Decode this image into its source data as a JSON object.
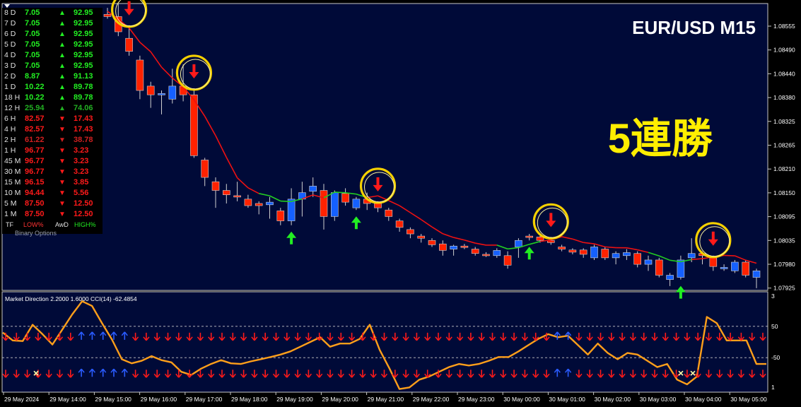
{
  "header": {
    "symbol_timeframe": "EUR/USD M15",
    "banner": "5連勝"
  },
  "colors": {
    "background": "#000",
    "chart_bg": "#000a38",
    "bull_candle": "#1560ff",
    "bear_candle": "#ff2200",
    "down_line": "#ee1111",
    "up_line": "#22cc22",
    "oscillator": "#ff9f1a",
    "banner": "#ffee00",
    "ring": "#f5d000"
  },
  "signal_panel": {
    "rows": [
      {
        "tf": "8 D",
        "low": "7.05",
        "dir": "up",
        "high": "92.95"
      },
      {
        "tf": "7 D",
        "low": "7.05",
        "dir": "up",
        "high": "92.95"
      },
      {
        "tf": "6 D",
        "low": "7.05",
        "dir": "up",
        "high": "92.95"
      },
      {
        "tf": "5 D",
        "low": "7.05",
        "dir": "up",
        "high": "92.95"
      },
      {
        "tf": "4 D",
        "low": "7.05",
        "dir": "up",
        "high": "92.95"
      },
      {
        "tf": "3 D",
        "low": "7.05",
        "dir": "up",
        "high": "92.95"
      },
      {
        "tf": "2 D",
        "low": "8.87",
        "dir": "up",
        "high": "91.13"
      },
      {
        "tf": "1 D",
        "low": "10.22",
        "dir": "up",
        "high": "89.78"
      },
      {
        "tf": "18 H",
        "low": "10.22",
        "dir": "up",
        "high": "89.78"
      },
      {
        "tf": "12 H",
        "low": "25.94",
        "dir": "up-weak",
        "high": "74.06"
      },
      {
        "tf": "6 H",
        "low": "82.57",
        "dir": "down",
        "high": "17.43"
      },
      {
        "tf": "4 H",
        "low": "82.57",
        "dir": "down",
        "high": "17.43"
      },
      {
        "tf": "2 H",
        "low": "61.22",
        "dir": "down-weak",
        "high": "38.78"
      },
      {
        "tf": "1 H",
        "low": "96.77",
        "dir": "down",
        "high": "3.23"
      },
      {
        "tf": "45 M",
        "low": "96.77",
        "dir": "down",
        "high": "3.23"
      },
      {
        "tf": "30 M",
        "low": "96.77",
        "dir": "down",
        "high": "3.23"
      },
      {
        "tf": "15 M",
        "low": "96.15",
        "dir": "down",
        "high": "3.85"
      },
      {
        "tf": "10 M",
        "low": "94.44",
        "dir": "down",
        "high": "5.56"
      },
      {
        "tf": "5 M",
        "low": "87.50",
        "dir": "down",
        "high": "12.50"
      },
      {
        "tf": "1 M",
        "low": "87.50",
        "dir": "down",
        "high": "12.50"
      }
    ],
    "footer_tf": "TF",
    "footer_low": "LOW%",
    "footer_awd": "AwD",
    "footer_high": "HIGH%",
    "brand": "Binary Options",
    "arrow_up": "▲",
    "arrow_down": "▼"
  },
  "chart_data": [
    {
      "type": "candlestick",
      "symbol": "EUR/USD",
      "timeframe": "M15",
      "ylim": [
        1.07915,
        1.08575
      ],
      "y_ticks": [
        "1.08555",
        "1.08490",
        "1.08440",
        "1.08380",
        "1.08325",
        "1.08265",
        "1.08210",
        "1.08150",
        "1.08095",
        "1.08035",
        "1.07980",
        "1.07925"
      ],
      "x_ticks": [
        "29 May 2024",
        "29 May 14:00",
        "29 May 15:00",
        "29 May 16:00",
        "29 May 17:00",
        "29 May 18:00",
        "29 May 19:00",
        "29 May 20:00",
        "29 May 21:00",
        "29 May 22:00",
        "29 May 23:00",
        "30 May 00:00",
        "30 May 01:00",
        "30 May 02:00",
        "30 May 03:00",
        "30 May 04:00",
        "30 May 05:00"
      ],
      "candles": [
        {
          "o": 1.0855,
          "h": 1.08565,
          "l": 1.0854,
          "c": 1.08545
        },
        {
          "o": 1.08545,
          "h": 1.08575,
          "l": 1.085,
          "c": 1.0851
        },
        {
          "o": 1.08495,
          "h": 1.08525,
          "l": 1.08455,
          "c": 1.08465
        },
        {
          "o": 1.08445,
          "h": 1.08455,
          "l": 1.08355,
          "c": 1.08375
        },
        {
          "o": 1.08385,
          "h": 1.08395,
          "l": 1.08335,
          "c": 1.08365
        },
        {
          "o": 1.08365,
          "h": 1.08375,
          "l": 1.0832,
          "c": 1.08368
        },
        {
          "o": 1.08355,
          "h": 1.08425,
          "l": 1.08345,
          "c": 1.08385
        },
        {
          "o": 1.08385,
          "h": 1.08435,
          "l": 1.0835,
          "c": 1.08365
        },
        {
          "o": 1.08365,
          "h": 1.0838,
          "l": 1.0822,
          "c": 1.08225
        },
        {
          "o": 1.08215,
          "h": 1.0822,
          "l": 1.08155,
          "c": 1.08175
        },
        {
          "o": 1.08165,
          "h": 1.08175,
          "l": 1.08105,
          "c": 1.08145
        },
        {
          "o": 1.08145,
          "h": 1.0816,
          "l": 1.08115,
          "c": 1.08135
        },
        {
          "o": 1.08133,
          "h": 1.08165,
          "l": 1.0812,
          "c": 1.0813
        },
        {
          "o": 1.08125,
          "h": 1.08135,
          "l": 1.08105,
          "c": 1.0811
        },
        {
          "o": 1.08115,
          "h": 1.0812,
          "l": 1.0809,
          "c": 1.0811
        },
        {
          "o": 1.08112,
          "h": 1.0813,
          "l": 1.0808,
          "c": 1.08118
        },
        {
          "o": 1.08098,
          "h": 1.08105,
          "l": 1.08065,
          "c": 1.08075
        },
        {
          "o": 1.08075,
          "h": 1.0815,
          "l": 1.08065,
          "c": 1.08125
        },
        {
          "o": 1.08125,
          "h": 1.08165,
          "l": 1.08085,
          "c": 1.0814
        },
        {
          "o": 1.08143,
          "h": 1.08175,
          "l": 1.0813,
          "c": 1.08155
        },
        {
          "o": 1.08145,
          "h": 1.0816,
          "l": 1.08055,
          "c": 1.08085
        },
        {
          "o": 1.08085,
          "h": 1.08145,
          "l": 1.08075,
          "c": 1.0814
        },
        {
          "o": 1.08138,
          "h": 1.0815,
          "l": 1.0811,
          "c": 1.08118
        },
        {
          "o": 1.08105,
          "h": 1.0813,
          "l": 1.081,
          "c": 1.08125
        },
        {
          "o": 1.08125,
          "h": 1.0814,
          "l": 1.081,
          "c": 1.08115
        },
        {
          "o": 1.08115,
          "h": 1.0812,
          "l": 1.08095,
          "c": 1.08105
        },
        {
          "o": 1.081,
          "h": 1.08105,
          "l": 1.08075,
          "c": 1.08085
        },
        {
          "o": 1.08075,
          "h": 1.0808,
          "l": 1.0805,
          "c": 1.0806
        },
        {
          "o": 1.08055,
          "h": 1.0806,
          "l": 1.08035,
          "c": 1.08045
        },
        {
          "o": 1.0804,
          "h": 1.08045,
          "l": 1.08025,
          "c": 1.08035
        },
        {
          "o": 1.0803,
          "h": 1.08035,
          "l": 1.08015,
          "c": 1.0802
        },
        {
          "o": 1.08022,
          "h": 1.0803,
          "l": 1.07995,
          "c": 1.08007
        },
        {
          "o": 1.0801,
          "h": 1.0802,
          "l": 1.07995,
          "c": 1.08017
        },
        {
          "o": 1.08017,
          "h": 1.08022,
          "l": 1.0801,
          "c": 1.08015
        },
        {
          "o": 1.0801,
          "h": 1.08015,
          "l": 1.07995,
          "c": 1.08
        },
        {
          "o": 1.07998,
          "h": 1.08003,
          "l": 1.07992,
          "c": 1.07997
        },
        {
          "o": 1.07995,
          "h": 1.08012,
          "l": 1.0799,
          "c": 1.08007
        },
        {
          "o": 1.07995,
          "h": 1.08005,
          "l": 1.07965,
          "c": 1.07973
        },
        {
          "o": 1.08015,
          "h": 1.08035,
          "l": 1.0799,
          "c": 1.0803
        },
        {
          "o": 1.0804,
          "h": 1.08045,
          "l": 1.0803,
          "c": 1.08038
        },
        {
          "o": 1.08038,
          "h": 1.08045,
          "l": 1.08025,
          "c": 1.0803
        },
        {
          "o": 1.0803,
          "h": 1.08038,
          "l": 1.0802,
          "c": 1.08025
        },
        {
          "o": 1.08015,
          "h": 1.0802,
          "l": 1.08005,
          "c": 1.0801
        },
        {
          "o": 1.08008,
          "h": 1.08012,
          "l": 1.07998,
          "c": 1.08003
        },
        {
          "o": 1.08008,
          "h": 1.08012,
          "l": 1.0799,
          "c": 1.07998
        },
        {
          "o": 1.0799,
          "h": 1.0802,
          "l": 1.07985,
          "c": 1.08015
        },
        {
          "o": 1.0801,
          "h": 1.08015,
          "l": 1.07985,
          "c": 1.0799
        },
        {
          "o": 1.0799,
          "h": 1.08005,
          "l": 1.07975,
          "c": 1.08
        },
        {
          "o": 1.07995,
          "h": 1.0801,
          "l": 1.07985,
          "c": 1.08002
        },
        {
          "o": 1.08,
          "h": 1.08005,
          "l": 1.07968,
          "c": 1.07975
        },
        {
          "o": 1.07975,
          "h": 1.07995,
          "l": 1.0796,
          "c": 1.07985
        },
        {
          "o": 1.07985,
          "h": 1.0799,
          "l": 1.07945,
          "c": 1.0795
        },
        {
          "o": 1.0794,
          "h": 1.07955,
          "l": 1.07925,
          "c": 1.0795
        },
        {
          "o": 1.07945,
          "h": 1.07995,
          "l": 1.0794,
          "c": 1.07985
        },
        {
          "o": 1.0799,
          "h": 1.08035,
          "l": 1.0798,
          "c": 1.08
        },
        {
          "o": 1.08,
          "h": 1.08005,
          "l": 1.07975,
          "c": 1.07995
        },
        {
          "o": 1.0799,
          "h": 1.07995,
          "l": 1.0796,
          "c": 1.0797
        },
        {
          "o": 1.07965,
          "h": 1.07975,
          "l": 1.0796,
          "c": 1.07968
        },
        {
          "o": 1.0796,
          "h": 1.07985,
          "l": 1.07955,
          "c": 1.0798
        },
        {
          "o": 1.0798,
          "h": 1.07985,
          "l": 1.07945,
          "c": 1.0795
        },
        {
          "o": 1.07945,
          "h": 1.07965,
          "l": 1.0792,
          "c": 1.0796
        }
      ],
      "down_signals": [
        2,
        8,
        25,
        41,
        56
      ],
      "up_signals": [
        17,
        23,
        39,
        53
      ],
      "ringed_signals": [
        2,
        8,
        25,
        41,
        56
      ]
    },
    {
      "type": "line",
      "label": "Market Direction 2.2000 1.6000   CCI(14) -62.4854",
      "y_right_ticks": [
        "3",
        "50",
        "-50",
        "1"
      ],
      "levels": [
        50,
        -50
      ],
      "ylim": [
        -160,
        160
      ],
      "cci": [
        30,
        5,
        3,
        55,
        25,
        -8,
        40,
        88,
        130,
        115,
        60,
        8,
        -55,
        -68,
        -60,
        -45,
        -58,
        -65,
        -95,
        -105,
        -85,
        -70,
        -58,
        -68,
        -70,
        -62,
        -55,
        -48,
        -40,
        -30,
        -15,
        0,
        15,
        -15,
        -5,
        -5,
        10,
        55,
        -25,
        -85,
        -150,
        -145,
        -120,
        -110,
        -95,
        -80,
        -70,
        -75,
        -70,
        -60,
        -48,
        -48,
        -30,
        -10,
        10,
        25,
        15,
        20,
        -10,
        -40,
        -5,
        -35,
        -55,
        -35,
        -40,
        -60,
        -80,
        -70,
        -120,
        -135,
        -110,
        80,
        60,
        5,
        5,
        5,
        -70,
        -70
      ]
    }
  ]
}
